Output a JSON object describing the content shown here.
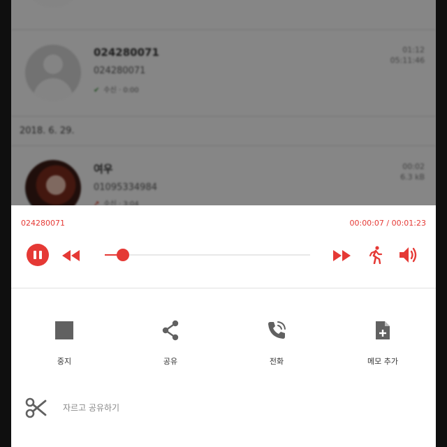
{
  "background_list": {
    "items": [
      {
        "name": "",
        "number": "",
        "tag": "",
        "right_line1": "",
        "right_line2": ""
      },
      {
        "name": "024280071",
        "number": "024280071",
        "tag": "수신 · 0:00",
        "right_line1": "01:12",
        "right_line2": "05:11:46"
      },
      {
        "name": "여우",
        "number": "01095334984",
        "tag": "수신 · 3:04",
        "right_line1": "00:02",
        "right_line2": "6.3 kB"
      }
    ],
    "date_header": "2018. 6. 29."
  },
  "player": {
    "number": "024280071",
    "time": "00:00:07 / 00:01:23",
    "progress_fraction": 0.09,
    "accent_color": "#e53935"
  },
  "actions": {
    "stop_label": "중지",
    "share_label": "공유",
    "call_label": "전화",
    "memo_label": "메모 추가",
    "trim_label": "자르고 공유하기"
  },
  "icons": {
    "pause": "pause-icon",
    "rewind": "rewind-icon",
    "fast_forward": "fast-forward-icon",
    "walk": "walking-person-icon",
    "volume": "volume-icon",
    "stop": "stop-icon",
    "share": "share-icon",
    "call": "phone-call-icon",
    "memo": "note-add-icon",
    "trim": "scissors-icon"
  }
}
